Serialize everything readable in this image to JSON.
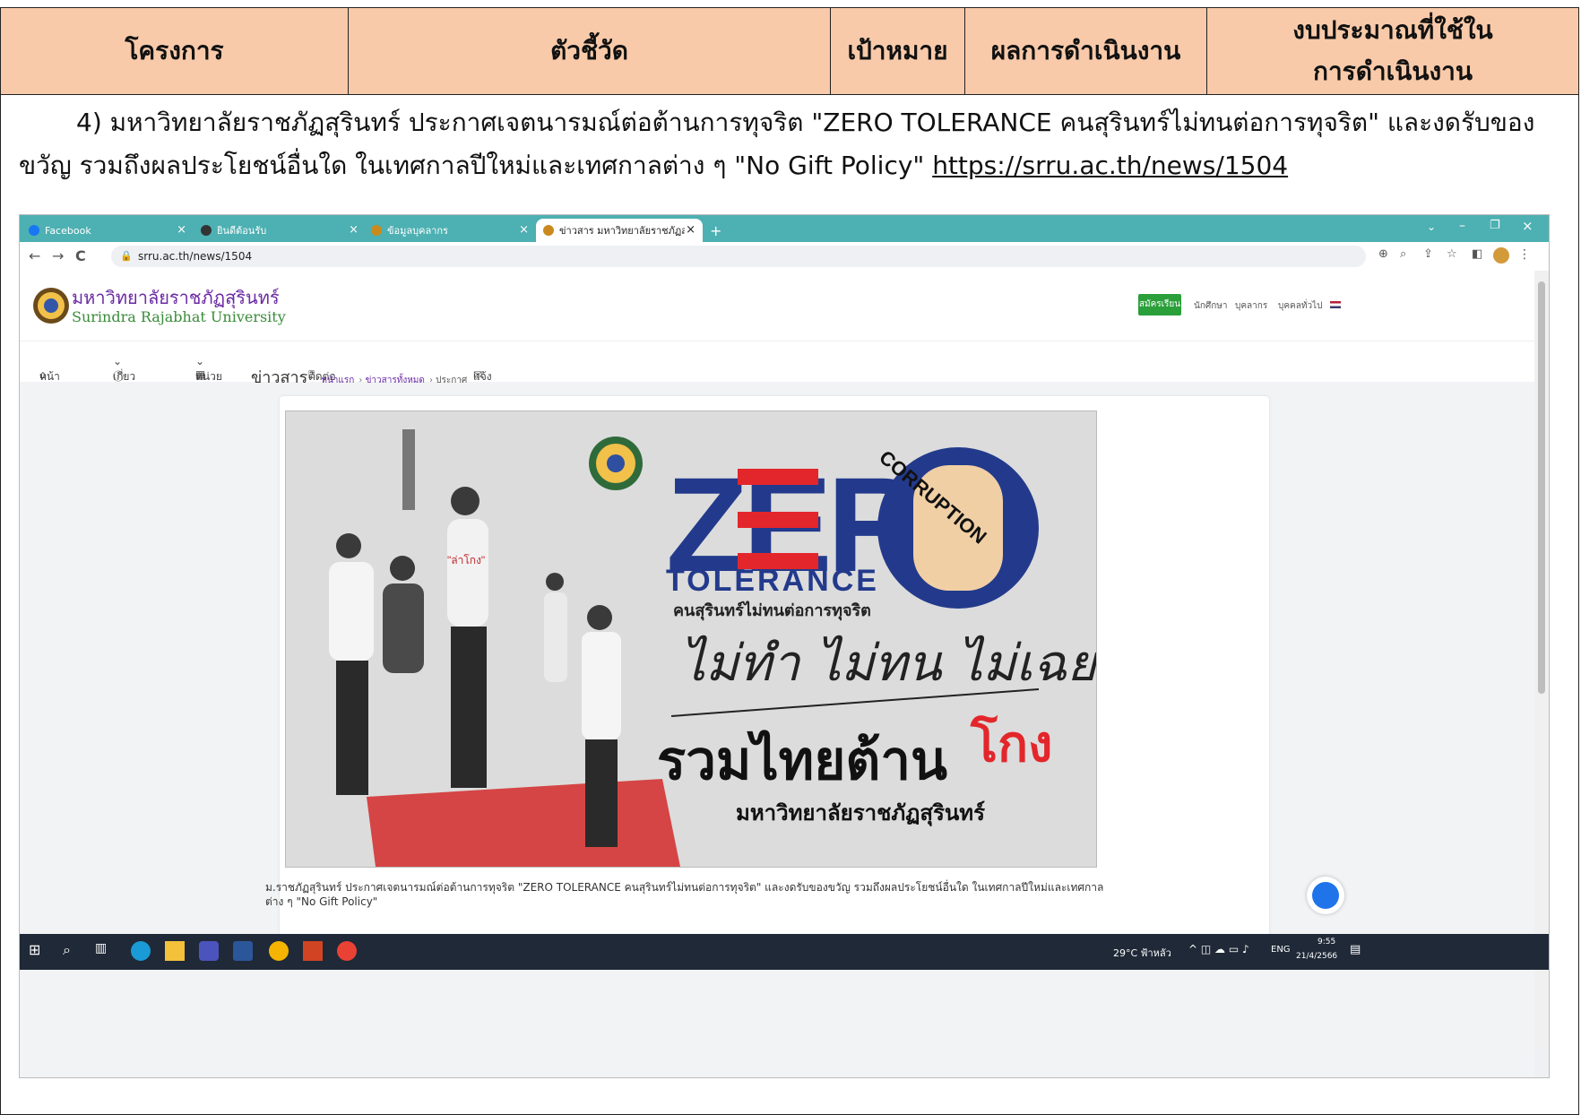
{
  "table_header": {
    "col1": "โครงการ",
    "col2": "ตัวชี้วัด",
    "col3": "เป้าหมาย",
    "col4": "ผลการดำเนินงาน",
    "col5_line1": "งบประมาณที่ใช้ใน",
    "col5_line2": "การดำเนินงาน"
  },
  "paragraph": {
    "text": "4) มหาวิทยาลัยราชภัฏสุรินทร์ ประกาศเจตนารมณ์ต่อต้านการทุจริต \"ZERO TOLERANCE คนสุรินทร์ไม่ทนต่อการทุจริต\" และงดรับของขวัญ รวมถึงผลประโยชน์อื่นใด ในเทศกาลปีใหม่และเทศกาลต่าง ๆ \"No Gift Policy\" ",
    "link": "https://srru.ac.th/news/1504"
  },
  "browser": {
    "tabs": [
      {
        "label": "Facebook",
        "icon": "facebook-icon"
      },
      {
        "label": "ยินดีต้อนรับ",
        "icon": "globe-icon"
      },
      {
        "label": "ข้อมูลบุคลากร",
        "icon": "university-logo-icon"
      },
      {
        "label": "ข่าวสาร มหาวิทยาลัยราชภัฏสุรินทร์ | S",
        "icon": "university-logo-icon"
      }
    ],
    "new_tab": "+",
    "url": "srru.ac.th/news/1504"
  },
  "site": {
    "name_th": "มหาวิทยาลัยราชภัฏสุรินทร์",
    "name_en": "Surindra Rajabhat University",
    "apply_button": "สมัครเรียน",
    "top_links": [
      "นักศึกษา",
      "บุคลากร",
      "บุคคลทั่วไป"
    ],
    "menu": [
      "หน้าแรก",
      "เกี่ยวกับ",
      "หน่วยงานภายใน",
      "ติดต่อสอบถาม/คำถามที่พบบ่อย",
      "แจ้งเรื่องร้องเรียนการทุจริต"
    ],
    "breadcrumb_title": "ข่าวสาร",
    "breadcrumb": [
      "หน้าแรก",
      "ข่าวสารทั้งหมด",
      "ประกาศ"
    ],
    "caption": "ม.ราชภัฏสุรินทร์ ประกาศเจตนารมณ์ต่อต้านการทุจริต \"ZERO TOLERANCE คนสุรินทร์ไม่ทนต่อการทุจริต\" และงดรับของขวัญ รวมถึงผลประโยชน์อื่นใด ในเทศกาลปีใหม่และเทศกาลต่าง ๆ \"No Gift Policy\""
  },
  "poster": {
    "zero": "ZERO",
    "tolerance": "TOLERANCE",
    "tagline": "คนสุรินทร์ไม่ทนต่อการทุจริต",
    "script": "ไม่ทำ ไม่ทน ไม่เฉย",
    "headline_a": "รวมไทยต้าน",
    "headline_b": "โกง",
    "university": "มหาวิทยาลัยราชภัฏสุรินทร์",
    "paper": "CORRUPTION",
    "shirt": "\"ล่าโกง\"",
    "colors": {
      "blue": "#233a8c",
      "red": "#e3262b",
      "grey": "#dcdcdc"
    }
  },
  "taskbar": {
    "weather": "29°C ฟ้าหลัว",
    "lang": "ENG",
    "time": "9:55",
    "date": "21/4/2566"
  }
}
